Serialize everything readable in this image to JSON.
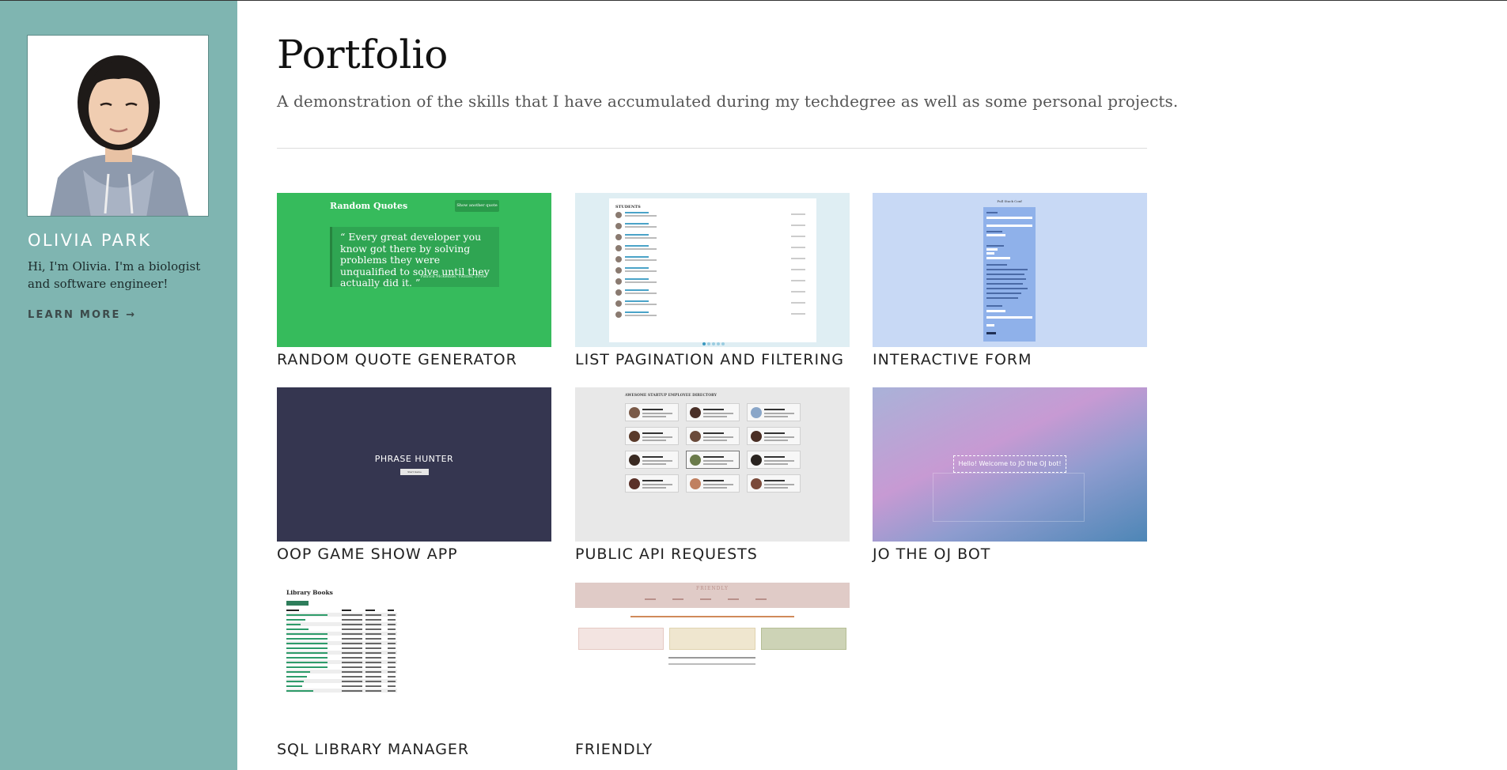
{
  "sidebar": {
    "name": "OLIVIA PARK",
    "bio": "Hi, I'm Olivia. I'm a biologist and software engineer!",
    "learn_more": "LEARN MORE →"
  },
  "main": {
    "title": "Portfolio",
    "subtitle": "A demonstration of the skills that I have accumulated during my techdegree as well as some personal projects."
  },
  "projects": [
    {
      "caption": "RANDOM QUOTE GENERATOR"
    },
    {
      "caption": "LIST PAGINATION AND FILTERING"
    },
    {
      "caption": "INTERACTIVE FORM"
    },
    {
      "caption": "OOP GAME SHOW APP"
    },
    {
      "caption": "PUBLIC API REQUESTS"
    },
    {
      "caption": "JO THE OJ BOT"
    },
    {
      "caption": "SQL LIBRARY MANAGER"
    },
    {
      "caption": "FRIENDLY"
    }
  ],
  "thumbs": {
    "quote_heading": "Random Quotes",
    "quote_button": "Show another quote",
    "quote_text": "“ Every great developer you know got there by solving problems they were unqualified to solve until they actually did it. ”",
    "quote_cite": "Patrick McKenzie, Twitter, 2016",
    "list_heading": "STUDENTS",
    "form_heading": "Full Stack Conf",
    "phrase_title": "PHRASE HUNTER",
    "phrase_button": "Start Game",
    "api_heading": "AWESOME STARTUP EMPLOYEE DIRECTORY",
    "bot_text": "Hello! Welcome to JO the OJ bot!",
    "library_heading": "Library Books",
    "friendly_brand": "FRIENDLY"
  },
  "colors": {
    "sidebar": "#7fb5b1",
    "quote_bg": "#36bb5c",
    "phrase_bg": "#353650"
  }
}
